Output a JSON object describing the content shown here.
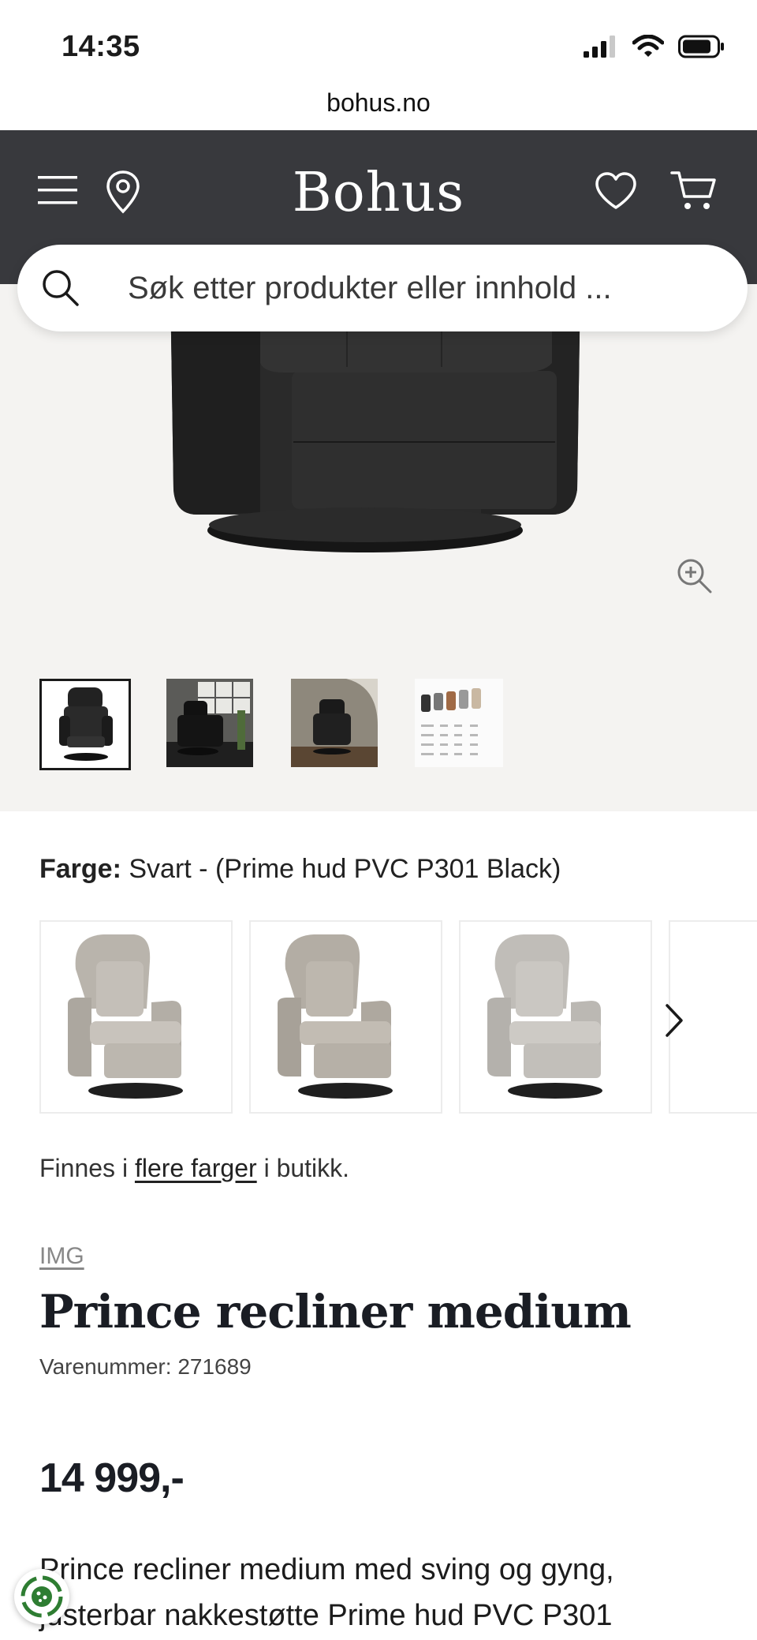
{
  "status_bar": {
    "time": "14:35"
  },
  "browser": {
    "url": "bohus.no"
  },
  "header": {
    "logo": "Bohus"
  },
  "search": {
    "placeholder": "Søk etter produkter eller innhold ..."
  },
  "color_selector": {
    "label": "Farge:",
    "value": "Svart - (Prime hud PVC P301 Black)"
  },
  "availability": {
    "prefix": "Finnes i ",
    "link": "flere farger",
    "suffix": " i butikk."
  },
  "product": {
    "brand": "IMG",
    "title": "Prince recliner medium",
    "sku": "Varenummer: 271689",
    "price": "14 999,-",
    "description_line1": "Prince recliner medium med sving og gyng,",
    "description_line2": "justerbar nakkestøtte Prime hud PVC P301"
  },
  "colors": {
    "header_bg": "#38393d",
    "gallery_bg": "#f4f3f1",
    "text_dark": "#1a1d24"
  }
}
